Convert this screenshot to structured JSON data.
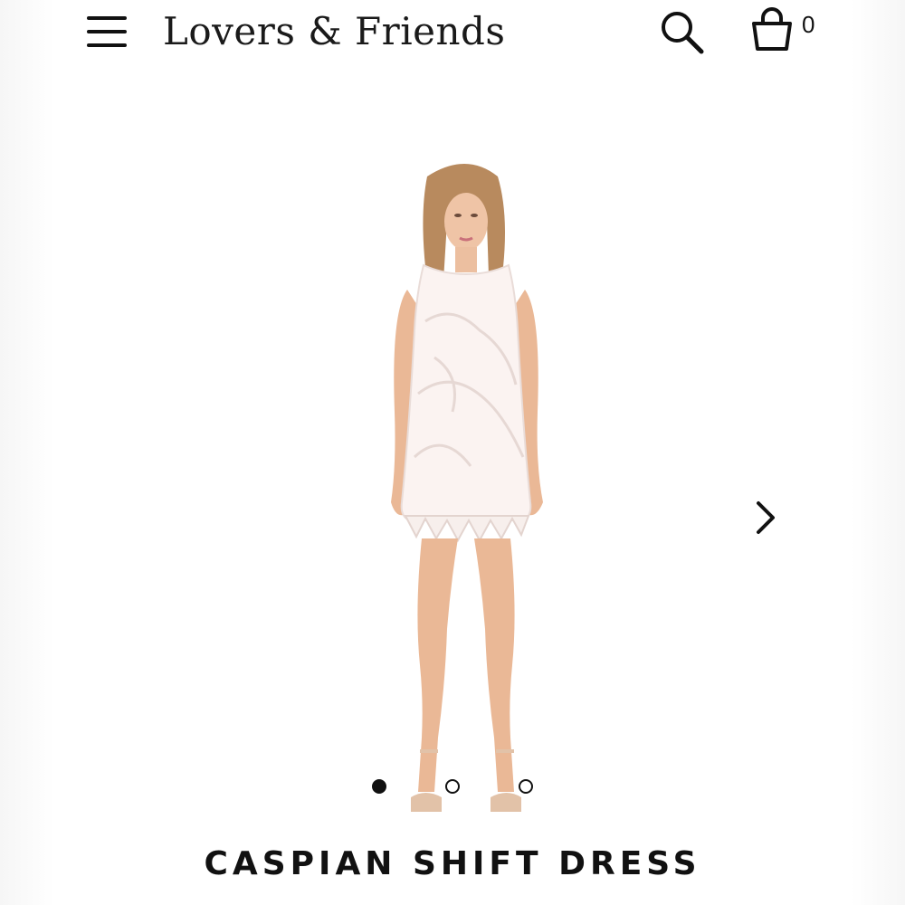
{
  "header": {
    "brand": "Lovers & Friends",
    "menu_icon": "hamburger-menu-icon",
    "search_icon": "search-icon",
    "bag_icon": "shopping-bag-icon",
    "bag_count": "0"
  },
  "gallery": {
    "image_subject": "model wearing white lace shift dress",
    "next_icon": "chevron-right-icon",
    "slides": 3,
    "active_slide": 1
  },
  "product": {
    "title": "CASPIAN SHIFT DRESS"
  },
  "colors": {
    "text": "#111111",
    "background": "#ffffff"
  }
}
